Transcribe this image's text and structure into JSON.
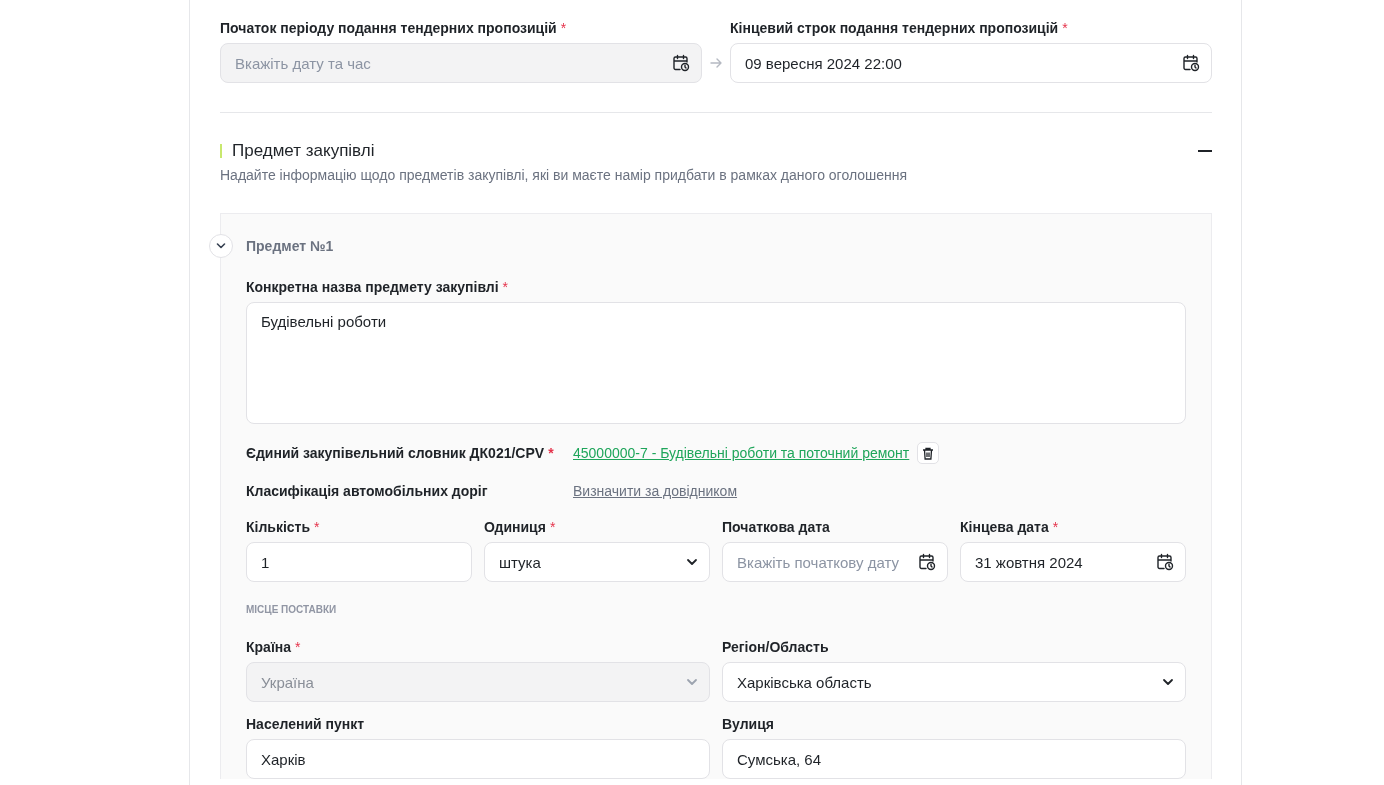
{
  "tender_period": {
    "start": {
      "kind": "date",
      "label": "Початок періоду подання тендерних пропозицій",
      "required_mark": "*",
      "placeholder": "Вкажіть дату та час",
      "disabled": true
    },
    "end": {
      "kind": "date",
      "label": "Кінцевий строк подання тендерних пропозицій",
      "required_mark": "*",
      "value": "09 вересня 2024 22:00",
      "disabled": false
    }
  },
  "section": {
    "title": "Предмет закупівлі",
    "subtitle": "Надайте інформацію щодо предметів закупівлі, які ви маєте намір придбати в рамках даного оголошення",
    "expanded": true
  },
  "items": [
    {
      "title": "Предмет №1",
      "expanded": true,
      "name_field": {
        "kind": "textarea",
        "label": "Конкретна назва предмету закупівлі",
        "required_mark": "*",
        "value": "Будівельні роботи",
        "disabled": false
      },
      "classifiers": [
        {
          "kind": "code",
          "label": "Єдиний закупівельний словник ДК021/CPV",
          "required_mark": "*",
          "link": "45000000-7 - Будівельні роботи та поточний ремонт"
        },
        {
          "kind": "lookup",
          "label": "Класифікація автомобільних доріг",
          "link": "Визначити за довідником"
        }
      ],
      "fields": [
        {
          "kind": "text",
          "label": "Кількість",
          "required_mark": "*",
          "value": "1",
          "disabled": false
        },
        {
          "kind": "select",
          "label": "Одиниця",
          "required_mark": "*",
          "value": "штука",
          "disabled": false
        },
        {
          "kind": "date",
          "label": "Початкова дата",
          "placeholder": "Вкажіть початкову дату",
          "disabled": false
        },
        {
          "kind": "date",
          "label": "Кінцева дата",
          "required_mark": "*",
          "value": "31 жовтня 2024",
          "disabled": false
        }
      ],
      "delivery": {
        "heading": "МІСЦЕ ПОСТАВКИ",
        "fields": [
          {
            "kind": "select",
            "label": "Країна",
            "required_mark": "*",
            "value": "Україна",
            "disabled": true
          },
          {
            "kind": "select",
            "label": "Регіон/Область",
            "value": "Харківська область",
            "disabled": false
          },
          {
            "kind": "text",
            "label": "Населений пункт",
            "value": "Харків",
            "disabled": false
          },
          {
            "kind": "text",
            "label": "Вулиця",
            "value": "Сумська, 64",
            "disabled": false
          }
        ]
      }
    }
  ]
}
